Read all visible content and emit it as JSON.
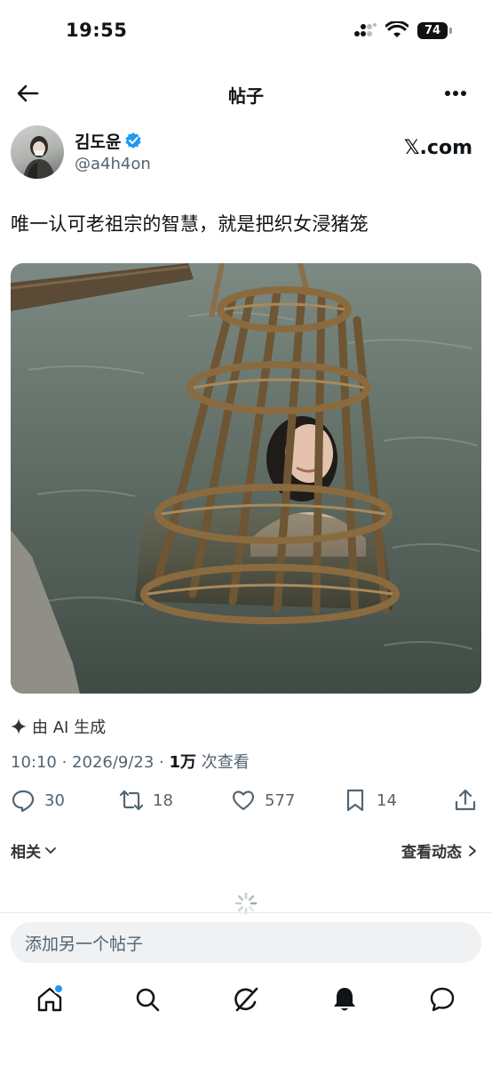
{
  "status_bar": {
    "time": "19:55",
    "battery": "74"
  },
  "header": {
    "title": "帖子"
  },
  "author": {
    "name": "김도윤",
    "handle": "@a4h4on",
    "source": "𝕏.com"
  },
  "post": {
    "text": "唯一认可老祖宗的智慧，就是把织女浸猪笼",
    "ai_label": "由 AI 生成",
    "timestamp": "10:10 · 2026/9/23 · ",
    "views_count": "1万",
    "views_label": " 次查看"
  },
  "actions": {
    "replies": "30",
    "reposts": "18",
    "likes": "577",
    "bookmarks": "14"
  },
  "related": {
    "label": "相关",
    "view_activity": "查看动态"
  },
  "reply": {
    "placeholder": "添加另一个帖子"
  },
  "colors": {
    "verified": "#1d9bf0",
    "text": "#0f1419",
    "muted": "#536471",
    "water": "#5e6b63"
  },
  "tabs": [
    "home-icon",
    "search-icon",
    "grok-icon",
    "notifications-icon",
    "messages-icon"
  ]
}
